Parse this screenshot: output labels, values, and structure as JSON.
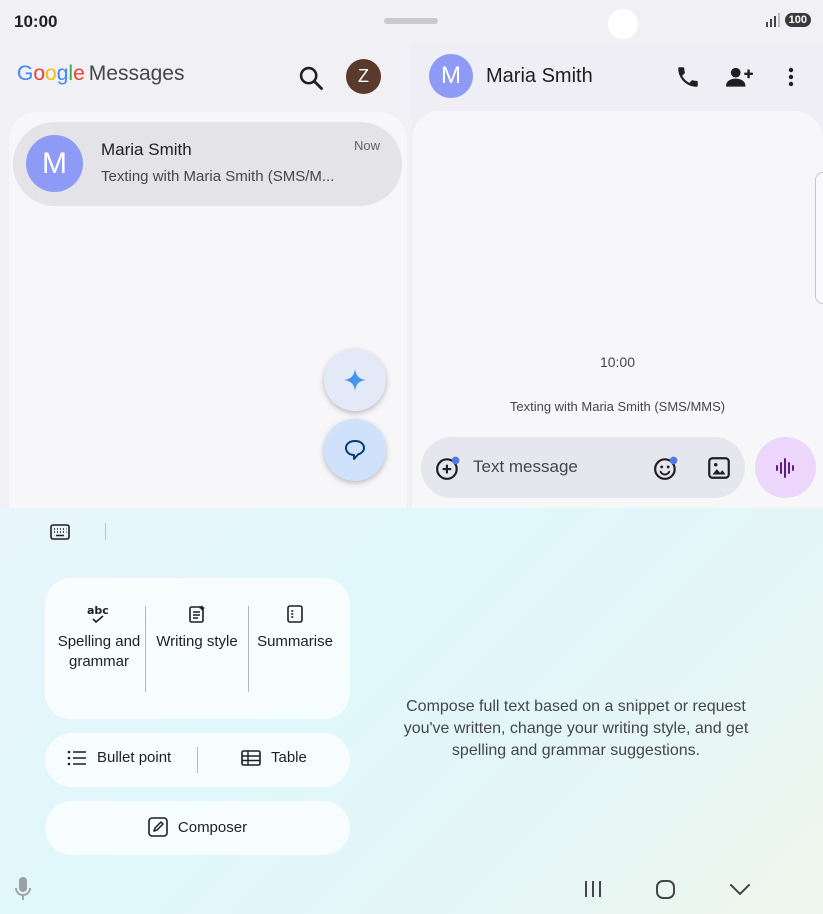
{
  "status_bar": {
    "time": "10:00",
    "battery": "100"
  },
  "left_pane": {
    "app_title": {
      "logo": [
        "G",
        "o",
        "o",
        "g",
        "l",
        "e"
      ],
      "logo_colors": [
        "#4285F4",
        "#EA4335",
        "#FBBC05",
        "#4285F4",
        "#34A853",
        "#EA4335"
      ],
      "product": "Messages"
    },
    "account_initial": "Z",
    "conversations": [
      {
        "initial": "M",
        "name": "Maria Smith",
        "snippet": "Texting with Maria Smith (SMS/M...",
        "time": "Now"
      }
    ]
  },
  "right_pane": {
    "contact_initial": "M",
    "contact_name": "Maria Smith",
    "timestamp": "10:00",
    "system_message": "Texting with Maria Smith (SMS/MMS)",
    "compose_placeholder": "Text message"
  },
  "writing_tools": {
    "tools": [
      {
        "icon": "spellcheck-icon",
        "label": "Spelling and grammar",
        "glyph": "abc"
      },
      {
        "icon": "writing-style-icon",
        "label": "Writing style"
      },
      {
        "icon": "summarise-icon",
        "label": "Summarise"
      }
    ],
    "bullet_point": "Bullet point",
    "table": "Table",
    "composer": "Composer",
    "description": "Compose full text based on a snippet or request you've written, change your writing style, and get spelling and grammar suggestions."
  },
  "colors": {
    "accent_avatar": "#8d9bf7",
    "account_avatar": "#5b3a2e",
    "voice_button": "#ecd6fc"
  }
}
